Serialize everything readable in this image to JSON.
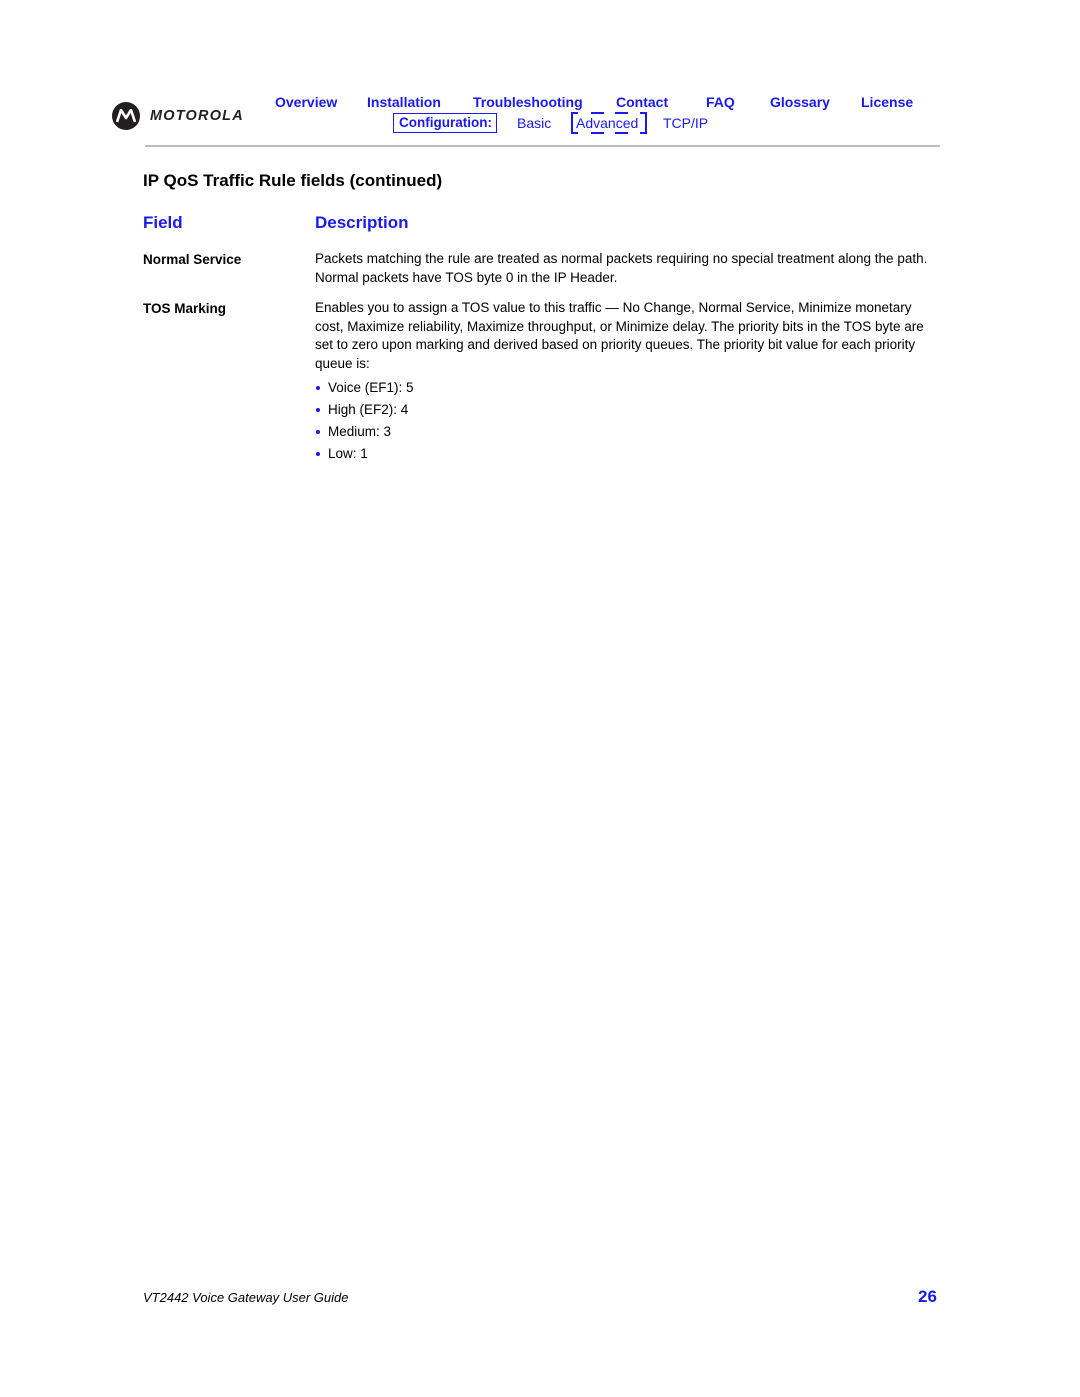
{
  "header": {
    "brand": "MOTOROLA",
    "nav": [
      {
        "label": "Overview"
      },
      {
        "label": "Installation"
      },
      {
        "label": "Troubleshooting"
      },
      {
        "label": "Contact"
      },
      {
        "label": "FAQ"
      },
      {
        "label": "Glossary"
      },
      {
        "label": "License"
      }
    ],
    "subnav": {
      "section_label": "Configuration:",
      "items": [
        {
          "label": "Basic"
        },
        {
          "label": "Advanced",
          "current": true
        },
        {
          "label": "TCP/IP"
        }
      ]
    }
  },
  "main": {
    "title": "IP QoS Traffic Rule fields (continued)",
    "table": {
      "headers": [
        "Field",
        "Description"
      ],
      "rows": [
        {
          "field": "Normal Service",
          "description": "Packets matching the rule are treated as normal packets requiring no special treatment along the path. Normal packets have TOS byte 0 in the IP Header."
        },
        {
          "field": "TOS Marking",
          "description": "Enables you to assign a TOS value to this traffic — No Change, Normal Service, Minimize monetary cost, Maximize reliability, Maximize throughput, or Minimize delay. The priority bits in the TOS byte are set to zero upon marking and derived based on priority queues. The priority bit value for each priority queue is:",
          "bullets": [
            "Voice (EF1): 5",
            "High (EF2): 4",
            "Medium: 3",
            "Low: 1"
          ]
        }
      ]
    }
  },
  "footer": {
    "doc_title": "VT2442 Voice Gateway User Guide",
    "page_number": "26"
  },
  "colors": {
    "link": "#1a1aee",
    "separator": "#bdbdbd",
    "text": "#000000"
  }
}
